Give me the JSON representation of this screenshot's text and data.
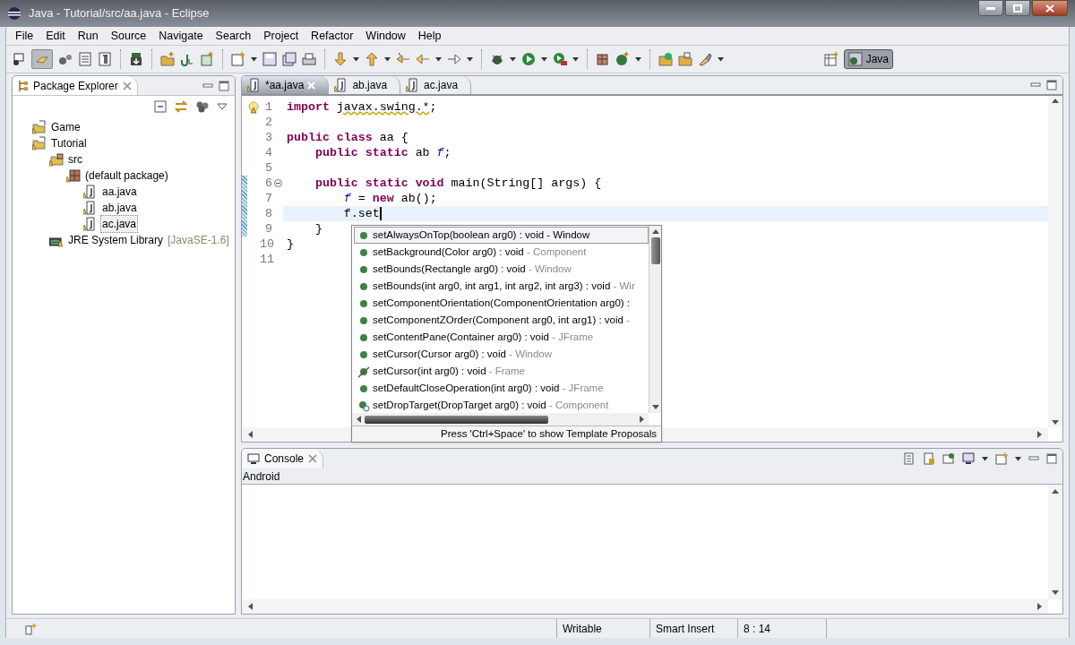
{
  "window": {
    "title": "Java - Tutorial/src/aa.java - Eclipse"
  },
  "menu": [
    "File",
    "Edit",
    "Run",
    "Source",
    "Navigate",
    "Search",
    "Project",
    "Refactor",
    "Window",
    "Help"
  ],
  "perspective": {
    "label": "Java",
    "selected": true
  },
  "package_explorer": {
    "title": "Package Explorer",
    "tree": [
      {
        "label": "Game",
        "kind": "project",
        "selected": false
      },
      {
        "label": "Tutorial",
        "kind": "project",
        "selected": false,
        "children": [
          {
            "label": "src",
            "kind": "source-folder",
            "selected": false,
            "children": [
              {
                "label": "(default package)",
                "kind": "package",
                "selected": false,
                "children": [
                  {
                    "label": "aa.java",
                    "kind": "file",
                    "selected": false
                  },
                  {
                    "label": "ab.java",
                    "kind": "file",
                    "selected": false
                  },
                  {
                    "label": "ac.java",
                    "kind": "file",
                    "selected": true
                  }
                ]
              }
            ]
          },
          {
            "label": "JRE System Library",
            "suffix": "[JavaSE-1.6]",
            "kind": "library",
            "selected": false
          }
        ]
      }
    ]
  },
  "editor_tabs": [
    {
      "label": "*aa.java",
      "selected": true
    },
    {
      "label": "ab.java",
      "selected": false
    },
    {
      "label": "ac.java",
      "selected": false
    }
  ],
  "code_lines": [
    {
      "number": "1",
      "warning": true,
      "fold": false,
      "changed": false,
      "current": false,
      "cursor": false,
      "tokens": [
        {
          "text": "import ",
          "kind": "keyword"
        },
        {
          "text": "javax.swing.*",
          "kind": "warn"
        },
        {
          "text": ";",
          "kind": "plain"
        }
      ]
    },
    {
      "number": "2",
      "warning": false,
      "fold": false,
      "changed": false,
      "current": false,
      "cursor": false
    },
    {
      "number": "3",
      "warning": false,
      "fold": false,
      "changed": false,
      "current": false,
      "cursor": false,
      "tokens": [
        {
          "text": "public class",
          "kind": "keyword"
        },
        {
          "text": " aa {",
          "kind": "plain"
        }
      ]
    },
    {
      "number": "4",
      "warning": false,
      "fold": false,
      "changed": false,
      "current": false,
      "cursor": false,
      "tokens": [
        {
          "text": "    public static",
          "kind": "keyword"
        },
        {
          "text": " ab ",
          "kind": "plain"
        },
        {
          "text": "f",
          "kind": "field"
        },
        {
          "text": ";",
          "kind": "plain"
        }
      ]
    },
    {
      "number": "5",
      "warning": false,
      "fold": false,
      "changed": false,
      "current": false,
      "cursor": false
    },
    {
      "number": "6",
      "warning": false,
      "fold": true,
      "changed": true,
      "current": false,
      "cursor": false,
      "tokens": [
        {
          "text": "    public static void",
          "kind": "keyword"
        },
        {
          "text": " main(String[] args) {",
          "kind": "plain"
        }
      ]
    },
    {
      "number": "7",
      "warning": false,
      "fold": false,
      "changed": true,
      "current": false,
      "cursor": false,
      "tokens": [
        {
          "text": "        f",
          "kind": "field"
        },
        {
          "text": " = ",
          "kind": "plain"
        },
        {
          "text": "new",
          "kind": "keyword"
        },
        {
          "text": " ab();",
          "kind": "plain"
        }
      ]
    },
    {
      "number": "8",
      "warning": false,
      "fold": false,
      "changed": true,
      "current": true,
      "cursor": true,
      "tokens": [
        {
          "text": "        f.set",
          "kind": "plain"
        }
      ]
    },
    {
      "number": "9",
      "warning": false,
      "fold": false,
      "changed": true,
      "current": false,
      "cursor": false,
      "tokens": [
        {
          "text": "    }",
          "kind": "plain"
        }
      ]
    },
    {
      "number": "10",
      "warning": false,
      "fold": false,
      "changed": false,
      "current": false,
      "cursor": false,
      "tokens": [
        {
          "text": "}",
          "kind": "plain"
        }
      ]
    },
    {
      "number": "11",
      "warning": false,
      "fold": false,
      "changed": false,
      "current": false,
      "cursor": false
    }
  ],
  "proposals": {
    "items": [
      {
        "signature": "setAlwaysOnTop(boolean arg0) : void",
        "owner": "- Window",
        "kind": "public",
        "selected": true
      },
      {
        "signature": "setBackground(Color arg0) : void",
        "owner": "- Component",
        "kind": "public",
        "selected": false
      },
      {
        "signature": "setBounds(Rectangle arg0) : void",
        "owner": "- Window",
        "kind": "public",
        "selected": false
      },
      {
        "signature": "setBounds(int arg0, int arg1, int arg2, int arg3) : void",
        "owner": "- Wir",
        "kind": "public",
        "selected": false
      },
      {
        "signature": "setComponentOrientation(ComponentOrientation arg0) :",
        "kind": "public",
        "selected": false
      },
      {
        "signature": "setComponentZOrder(Component arg0, int arg1) : void",
        "owner": "-",
        "kind": "public",
        "selected": false
      },
      {
        "signature": "setContentPane(Container arg0) : void",
        "owner": "- JFrame",
        "kind": "public",
        "selected": false
      },
      {
        "signature": "setCursor(Cursor arg0) : void",
        "owner": "- Window",
        "kind": "public",
        "selected": false
      },
      {
        "signature": "setCursor(int arg0) : void",
        "owner": "- Frame",
        "kind": "deprecated",
        "selected": false
      },
      {
        "signature": "setDefaultCloseOperation(int arg0) : void",
        "owner": "- JFrame",
        "kind": "public",
        "selected": false
      },
      {
        "signature": "setDropTarget(DropTarget arg0) : void",
        "owner": "- Component",
        "kind": "public-overlay",
        "selected": false
      }
    ],
    "footer": "Press 'Ctrl+Space' to show Template Proposals"
  },
  "console": {
    "title": "Console",
    "label": "Android"
  },
  "status_bar": {
    "mode": "Writable",
    "insert": "Smart Insert",
    "position": "8 : 14"
  }
}
